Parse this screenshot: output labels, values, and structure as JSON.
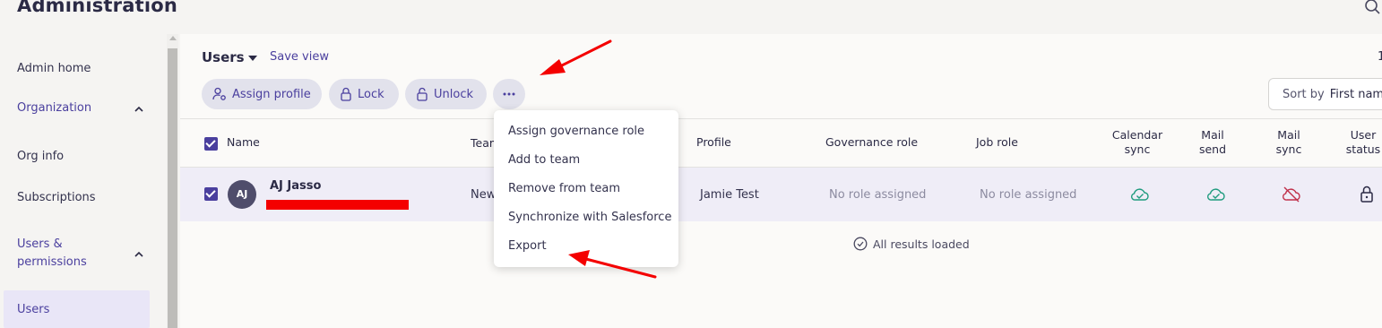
{
  "header": {
    "title": "Administration"
  },
  "sidebar": {
    "items": [
      {
        "label": "Admin home"
      },
      {
        "label": "Organization"
      },
      {
        "label": "Org info"
      },
      {
        "label": "Subscriptions"
      },
      {
        "label": "Users & permissions"
      },
      {
        "label": "Users"
      }
    ]
  },
  "toolbar": {
    "view_label": "Users",
    "save_view": "Save view",
    "assign_profile": "Assign profile",
    "lock": "Lock",
    "unlock": "Unlock",
    "page_count": "1",
    "sort_label": "Sort by",
    "sort_value": "First name"
  },
  "table": {
    "columns": {
      "name": "Name",
      "team": "Team",
      "profile": "Profile",
      "governance_role": "Governance role",
      "job_role": "Job role",
      "calendar_sync": "Calendar sync",
      "mail_send": "Mail send",
      "mail_sync": "Mail sync",
      "user_status": "User status"
    },
    "rows": [
      {
        "initials": "AJ",
        "name": "AJ Jasso",
        "team": "New",
        "profile": "Jamie Test",
        "governance_role": "No role assigned",
        "job_role": "No role assigned",
        "calendar_sync": "cloud-check-icon",
        "mail_send": "cloud-check-icon",
        "mail_sync": "cloud-off-icon",
        "user_status": "lock-icon"
      }
    ],
    "footer": "All results loaded"
  },
  "more_menu": {
    "items": [
      {
        "label": "Assign governance role"
      },
      {
        "label": "Add to team"
      },
      {
        "label": "Remove from team"
      },
      {
        "label": "Synchronize with Salesforce"
      },
      {
        "label": "Export"
      }
    ]
  },
  "colors": {
    "accent": "#4a3f9e",
    "sync_ok": "#1f9b7e",
    "sync_off": "#c0304a",
    "annotation_arrow": "#f40000",
    "redaction": "#f40000"
  }
}
